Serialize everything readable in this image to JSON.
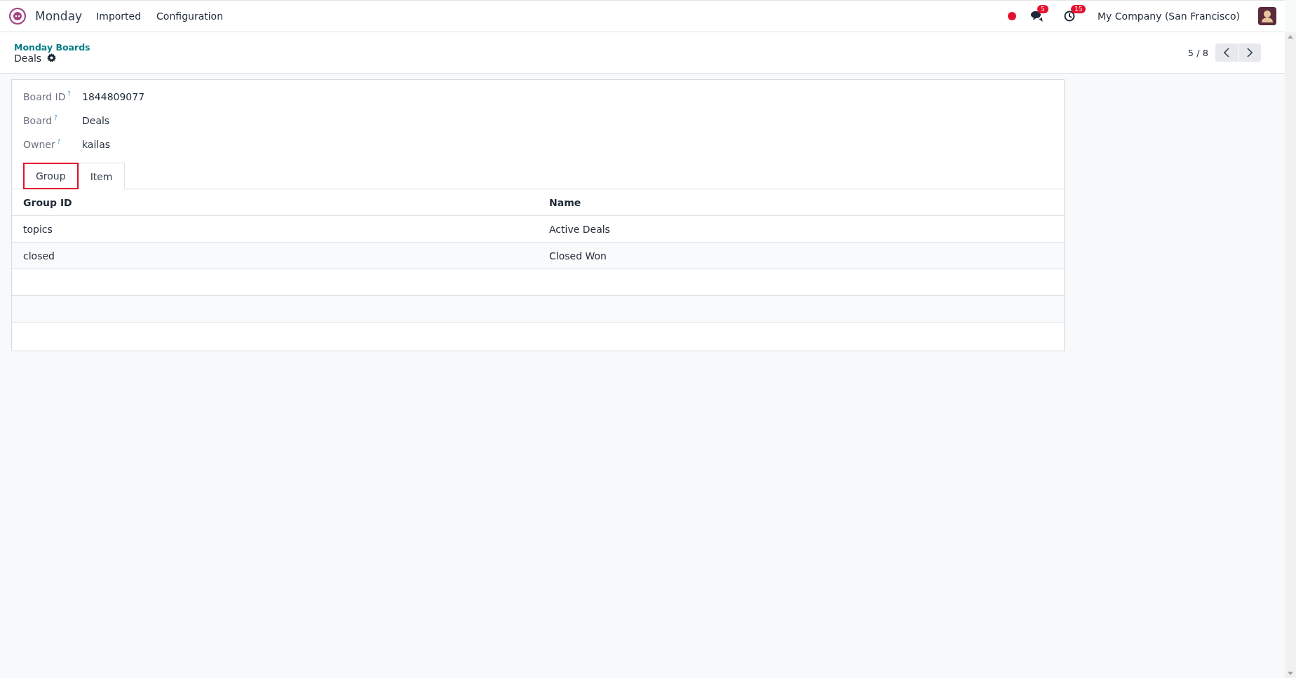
{
  "navbar": {
    "app_name": "Monday",
    "menus": [
      "Imported",
      "Configuration"
    ],
    "messages_count": "5",
    "activities_count": "15",
    "company": "My Company (San Francisco)"
  },
  "breadcrumb": {
    "parent": "Monday Boards",
    "current": "Deals"
  },
  "pager": {
    "value": "5 / 8"
  },
  "fields": [
    {
      "label": "Board ID",
      "help": "?",
      "value": "1844809077"
    },
    {
      "label": "Board",
      "help": "?",
      "value": "Deals"
    },
    {
      "label": "Owner",
      "help": "?",
      "value": "kailas"
    }
  ],
  "tabs": [
    {
      "label": "Group",
      "selected": true
    },
    {
      "label": "Item",
      "selected": false
    }
  ],
  "table": {
    "columns": [
      "Group ID",
      "Name"
    ],
    "rows": [
      [
        "topics",
        "Active Deals"
      ],
      [
        "closed",
        "Closed Won"
      ]
    ]
  }
}
